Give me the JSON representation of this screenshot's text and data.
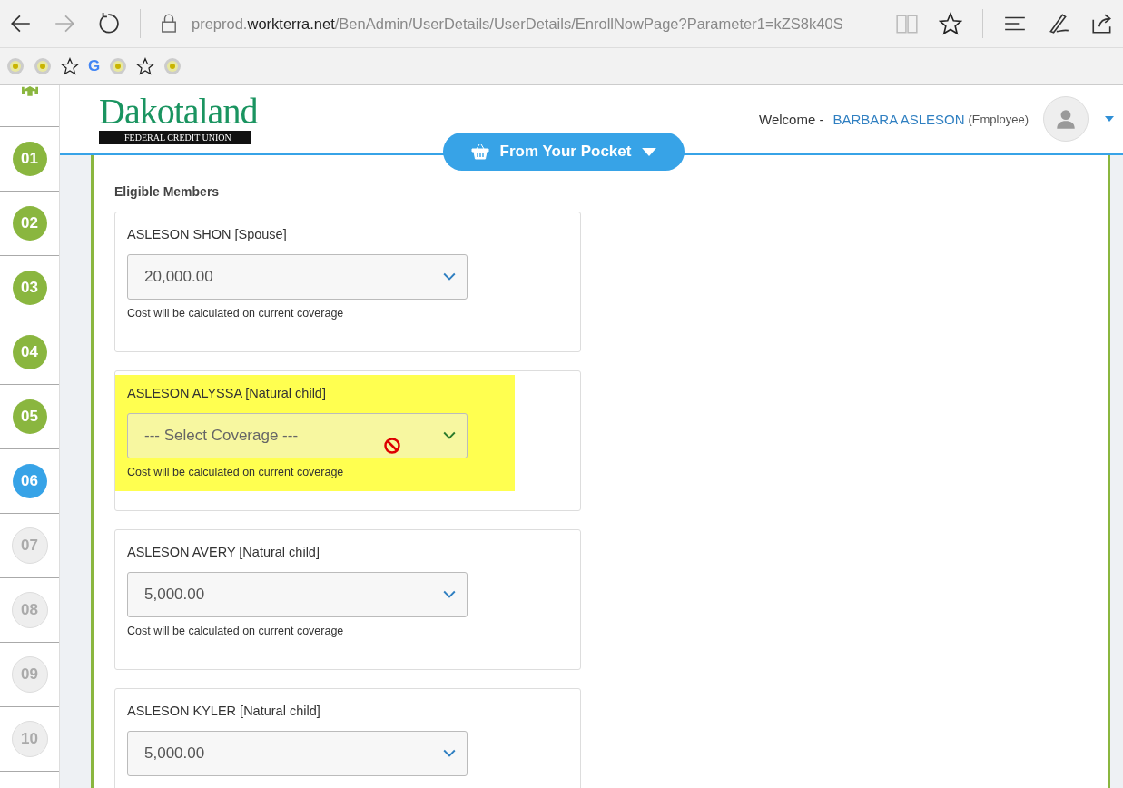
{
  "browser": {
    "url": {
      "prefix": "preprod.",
      "domain": "workterra.net",
      "path": "/BenAdmin/UserDetails/UserDetails/EnrollNowPage?Parameter1=kZS8k40S"
    },
    "bookmarks": [
      {
        "kind": "site"
      },
      {
        "kind": "site"
      },
      {
        "kind": "star"
      },
      {
        "kind": "google",
        "label": "G"
      },
      {
        "kind": "site"
      },
      {
        "kind": "star"
      },
      {
        "kind": "site"
      }
    ]
  },
  "steps": [
    {
      "label": "01",
      "completed": true,
      "selected": false
    },
    {
      "label": "02",
      "completed": true,
      "selected": false
    },
    {
      "label": "03",
      "completed": true,
      "selected": false
    },
    {
      "label": "04",
      "completed": true,
      "selected": false
    },
    {
      "label": "05",
      "completed": true,
      "selected": false
    },
    {
      "label": "06",
      "completed": false,
      "selected": true
    },
    {
      "label": "07",
      "completed": false,
      "selected": false
    },
    {
      "label": "08",
      "completed": false,
      "selected": false
    },
    {
      "label": "09",
      "completed": false,
      "selected": false
    },
    {
      "label": "10",
      "completed": false,
      "selected": false
    }
  ],
  "header": {
    "logo": {
      "name": "Dakotaland",
      "tagline": "FEDERAL CREDIT UNION"
    },
    "welcome": "Welcome -",
    "user": "BARBARA ASLESON",
    "role": "(Employee)"
  },
  "section_button": "From Your Pocket",
  "section_title": "Eligible Members",
  "members": [
    {
      "name": "ASLESON SHON [Spouse]",
      "value": "20,000.00",
      "note": "Cost will be calculated on current coverage",
      "highlighted": false,
      "blocked_cursor": false
    },
    {
      "name": "ASLESON ALYSSA [Natural child]",
      "placeholder": "--- Select Coverage ---",
      "note": "Cost will be calculated on current coverage",
      "highlighted": true,
      "blocked_cursor": true
    },
    {
      "name": "ASLESON AVERY [Natural child]",
      "value": "5,000.00",
      "note": "Cost will be calculated on current coverage",
      "highlighted": false,
      "blocked_cursor": false
    },
    {
      "name": "ASLESON KYLER [Natural child]",
      "value": "5,000.00",
      "highlighted": false,
      "blocked_cursor": false
    }
  ]
}
